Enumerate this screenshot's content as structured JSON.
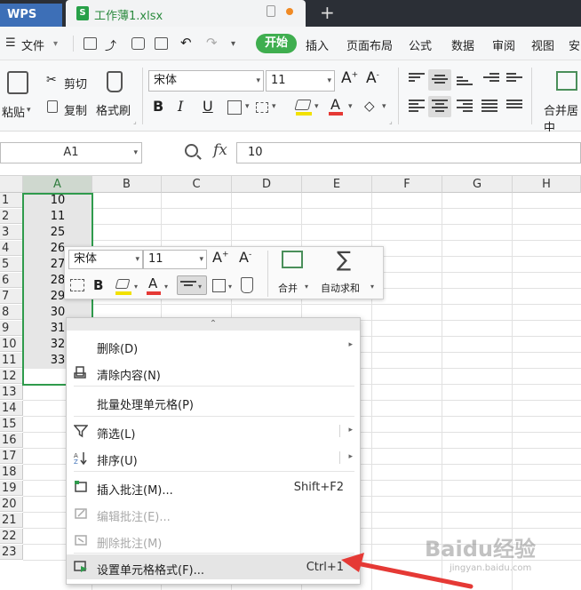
{
  "titlebar": {
    "app_tab": "WPS",
    "file_tab": "工作薄1.xlsx",
    "new_tab": "+"
  },
  "menubar": {
    "file": "文件",
    "start": "开始",
    "items": [
      "插入",
      "页面布局",
      "公式",
      "数据",
      "审阅",
      "视图",
      "安"
    ]
  },
  "ribbon": {
    "paste": "粘贴",
    "cut": "剪切",
    "copy": "复制",
    "format_painter": "格式刷",
    "font_name": "宋体",
    "font_size": "11",
    "merge_center": "合并居中"
  },
  "formula_bar": {
    "name_box": "A1",
    "fx": "fx",
    "value": "10"
  },
  "grid": {
    "columns": [
      "A",
      "B",
      "C",
      "D",
      "E",
      "F",
      "G",
      "H"
    ],
    "rows": [
      "1",
      "2",
      "3",
      "4",
      "5",
      "6",
      "7",
      "8",
      "9",
      "10",
      "11",
      "12",
      "13",
      "14",
      "15",
      "16",
      "17",
      "18",
      "19",
      "20",
      "21",
      "22",
      "23"
    ],
    "col_a_values": [
      "10",
      "11",
      "25",
      "26",
      "27",
      "28",
      "29",
      "30",
      "31",
      "32",
      "33"
    ]
  },
  "mini_toolbar": {
    "font_name": "宋体",
    "font_size": "11",
    "merge": "合并",
    "autosum": "自动求和"
  },
  "context_menu": {
    "items": [
      {
        "label": "删除(D)",
        "shortcut": "",
        "submenu": true,
        "disabled": false,
        "icon": "none"
      },
      {
        "label": "清除内容(N)",
        "shortcut": "",
        "submenu": false,
        "disabled": false,
        "icon": "eraser-icon"
      },
      {
        "label": "批量处理单元格(P)",
        "shortcut": "",
        "submenu": false,
        "disabled": false,
        "icon": "none"
      },
      {
        "label": "筛选(L)",
        "shortcut": "",
        "submenu": true,
        "disabled": false,
        "icon": "filter-icon"
      },
      {
        "label": "排序(U)",
        "shortcut": "",
        "submenu": true,
        "disabled": false,
        "icon": "sort-az-icon"
      },
      {
        "label": "插入批注(M)...",
        "shortcut": "Shift+F2",
        "submenu": false,
        "disabled": false,
        "icon": "insert-comment-icon"
      },
      {
        "label": "编辑批注(E)...",
        "shortcut": "",
        "submenu": false,
        "disabled": true,
        "icon": "edit-comment-icon"
      },
      {
        "label": "删除批注(M)",
        "shortcut": "",
        "submenu": false,
        "disabled": true,
        "icon": "delete-comment-icon"
      },
      {
        "label": "设置单元格格式(F)...",
        "shortcut": "Ctrl+1",
        "submenu": false,
        "disabled": false,
        "icon": "format-cells-icon"
      }
    ]
  },
  "watermark": {
    "text": "Baidu经验",
    "sub": "jingyan.baidu.com"
  },
  "colors": {
    "accent_green": "#3fae4f",
    "selection_border": "#2f9b4c",
    "arrow_red": "#e53935"
  }
}
